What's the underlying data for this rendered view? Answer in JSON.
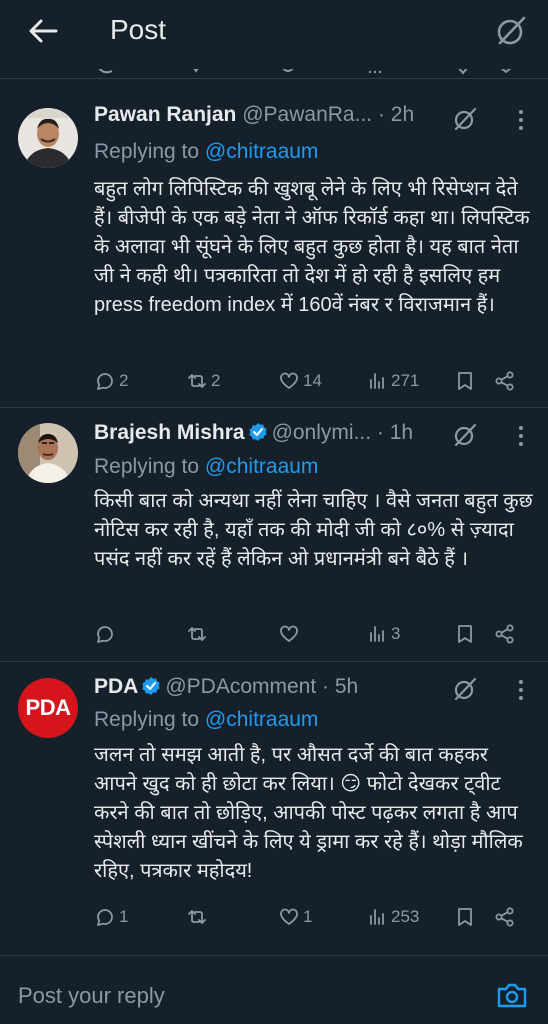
{
  "header": {
    "title": "Post"
  },
  "replies": [
    {
      "name": "Pawan Ranjan",
      "handle": "@PawanRa...",
      "time": "· 2h",
      "replying_prefix": "Replying to ",
      "replying_to": "@chitraaum",
      "text": "बहुत लोग लिपिस्टिक की खुशबू लेने के लिए भी रिसेप्शन देते हैं। बीजेपी के एक बड़े नेता ने ऑफ रिकॉर्ड कहा था। लिपस्टिक के अलावा भी सूंघने के लिए बहुत कुछ होता है। यह बात नेता जी ने कही थी। पत्रकारिता तो देश में हो रही है इसलिए हम press freedom index में 160वें नंबर र विराजमान हैं।",
      "replies_count": "2",
      "reposts_count": "2",
      "likes_count": "14",
      "views_count": "271",
      "verified": false
    },
    {
      "name": "Brajesh Mishra",
      "handle": "@onlymi...",
      "time": "· 1h",
      "replying_prefix": "Replying to ",
      "replying_to": "@chitraaum",
      "text": "किसी बात को अन्यथा नहीं लेना चाहिए । वैसे जनता बहुत कुछ नोटिस कर रही है, यहाँ तक की मोदी जी को ८०% से ज़्यादा पसंद नहीं कर रहें हैं लेकिन ओ प्रधानमंत्री बने बैठे हैं ।",
      "replies_count": "",
      "reposts_count": "",
      "likes_count": "",
      "views_count": "3",
      "verified": true
    },
    {
      "name": "PDA",
      "handle": "@PDAcomment",
      "time": "· 5h",
      "replying_prefix": "Replying to ",
      "replying_to": "@chitraaum",
      "text": "जलन तो समझ आती है, पर औसत दर्जे की बात कहकर आपने खुद को ही छोटा कर लिया। 😏 फोटो देखकर ट्वीट करने की बात तो छोड़िए, आपकी पोस्ट पढ़कर लगता है आप स्पेशली ध्यान खींचने के लिए ये ड्रामा कर रहे हैं। थोड़ा मौलिक रहिए, पत्रकार महोदय!",
      "replies_count": "1",
      "reposts_count": "",
      "likes_count": "1",
      "views_count": "253",
      "verified": true,
      "avatar_text": "PDA"
    }
  ],
  "composer": {
    "placeholder": "Post your reply"
  },
  "colors": {
    "background": "#16202b",
    "accent": "#1d9bf0",
    "muted": "#8b98a5",
    "divider": "#2f3a45",
    "pda_red": "#d6141c"
  }
}
